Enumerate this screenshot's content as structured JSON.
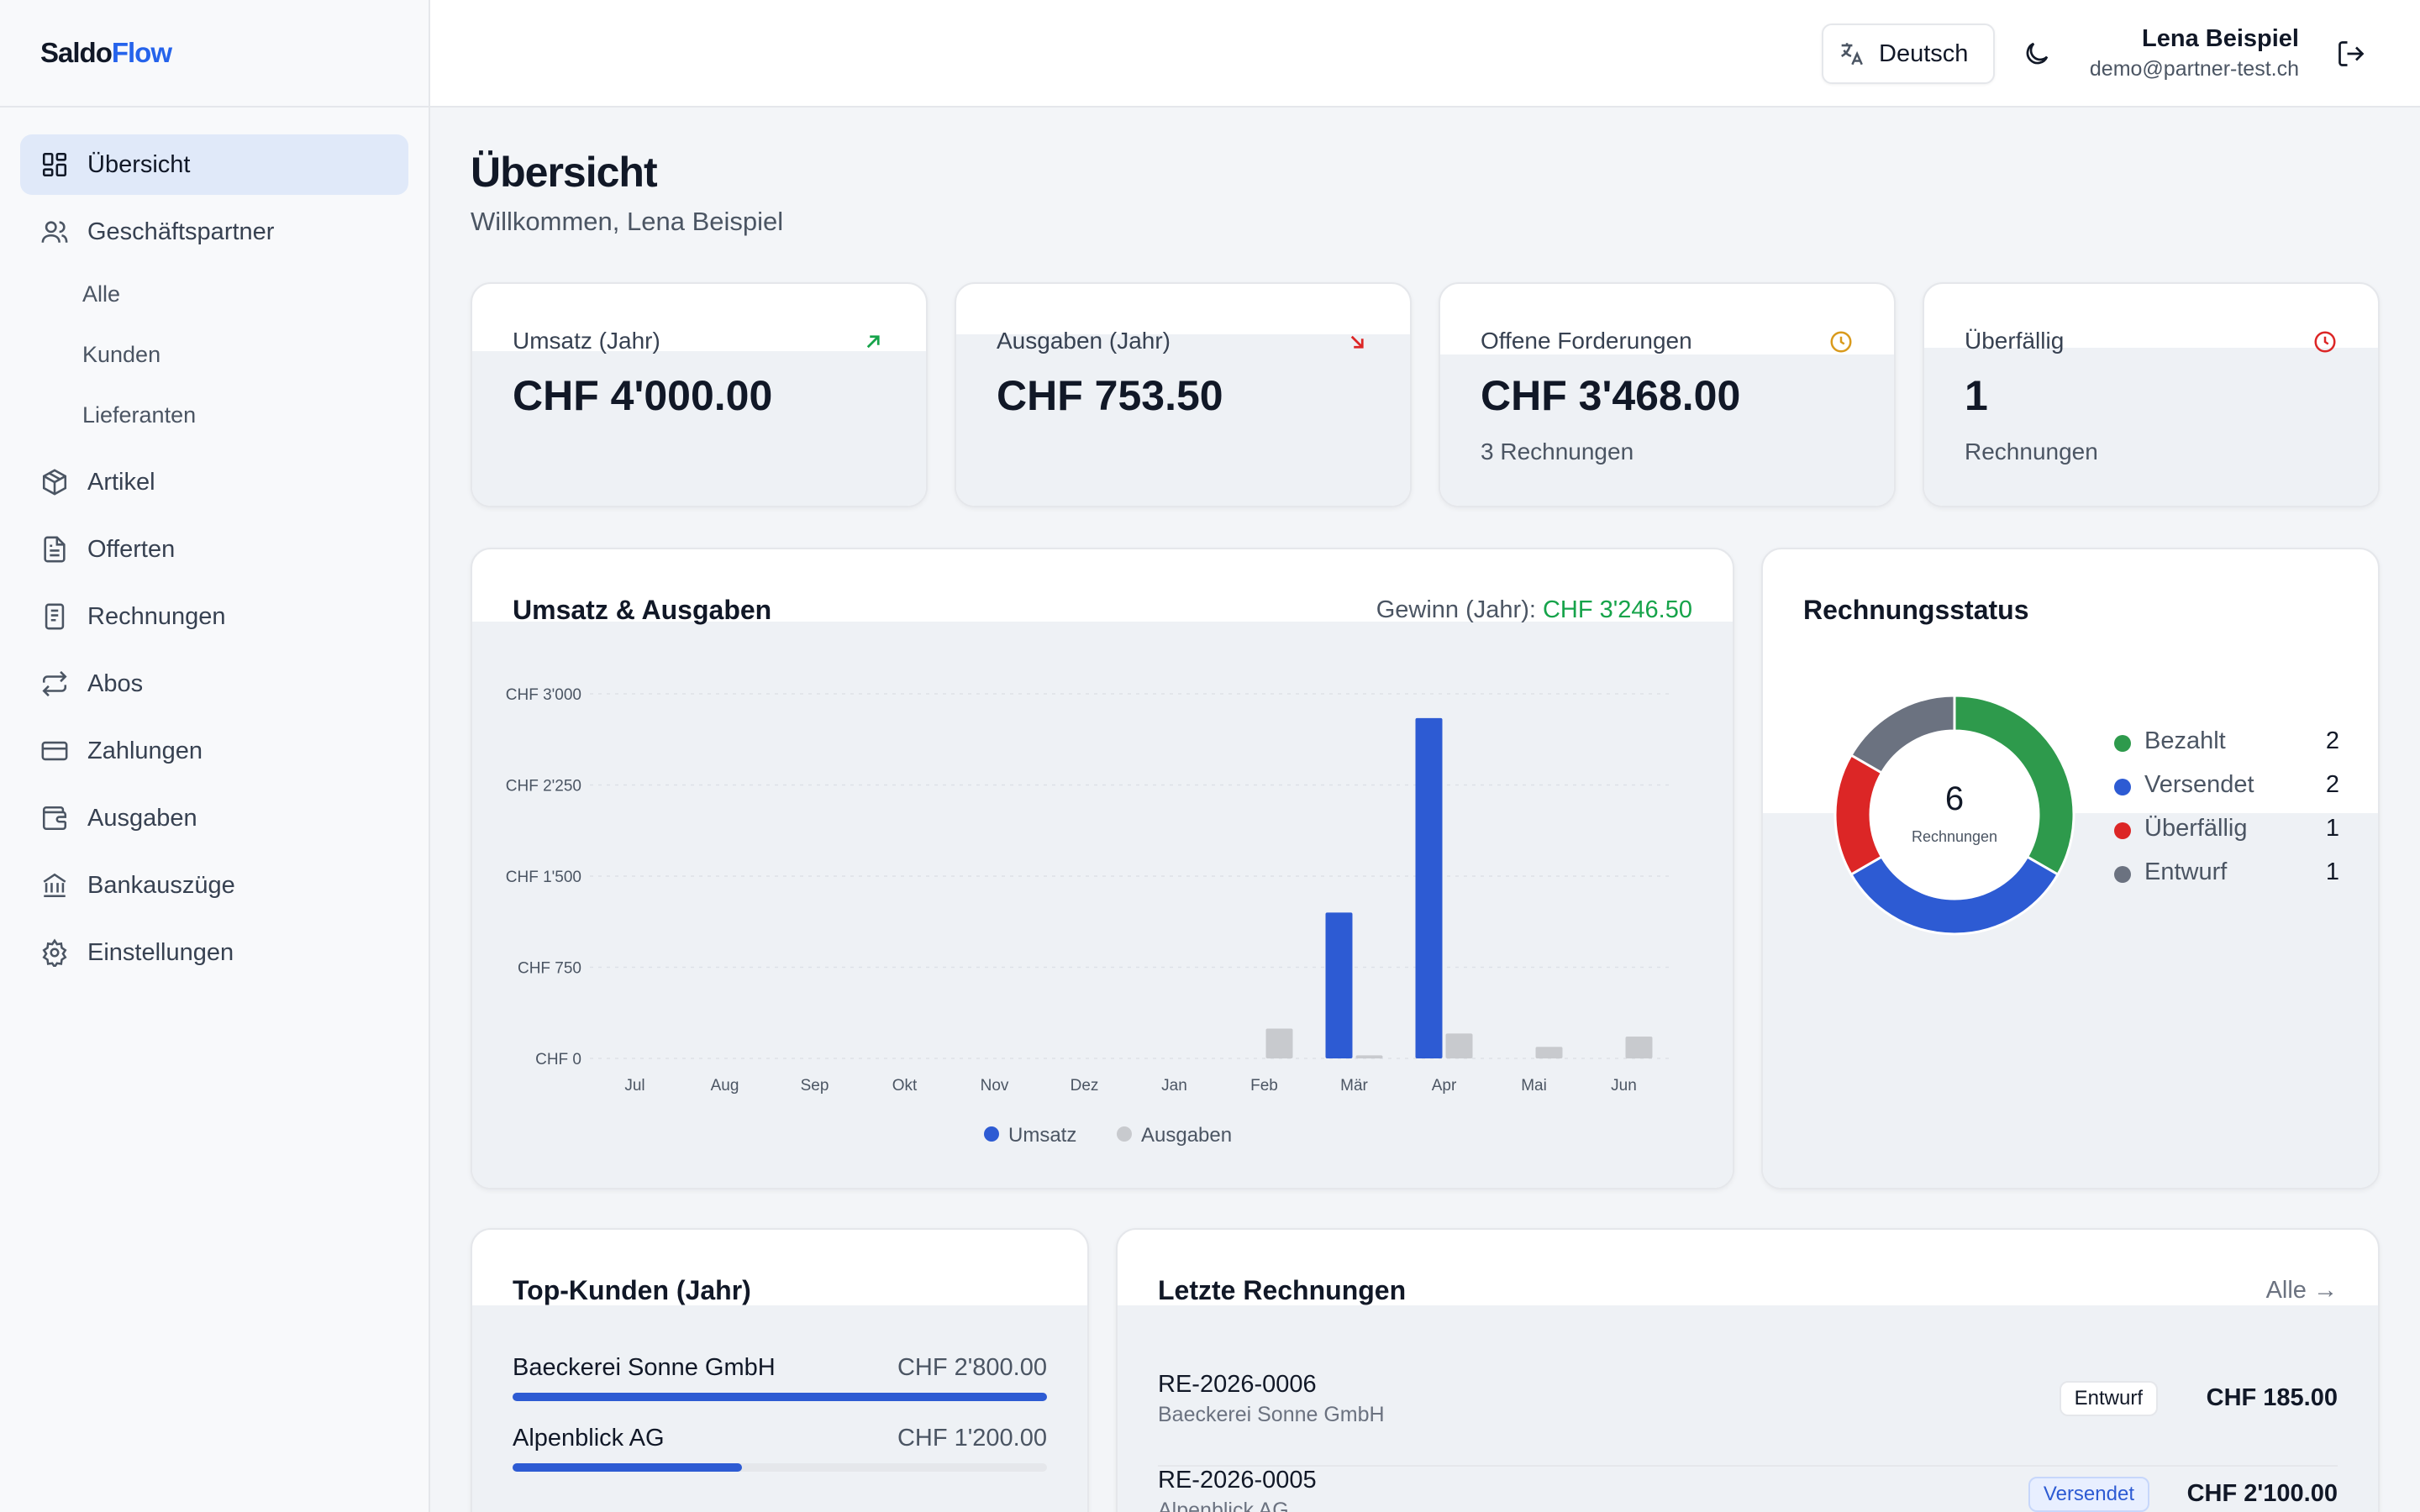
{
  "brand": {
    "part1": "Saldo",
    "part2": "Flow"
  },
  "sidebar": {
    "items": [
      {
        "label": "Übersicht",
        "icon": "dashboard-icon"
      },
      {
        "label": "Geschäftspartner",
        "icon": "users-icon"
      },
      {
        "label": "Artikel",
        "icon": "package-icon"
      },
      {
        "label": "Offerten",
        "icon": "file-text-icon"
      },
      {
        "label": "Rechnungen",
        "icon": "receipt-icon"
      },
      {
        "label": "Abos",
        "icon": "repeat-icon"
      },
      {
        "label": "Zahlungen",
        "icon": "credit-card-icon"
      },
      {
        "label": "Ausgaben",
        "icon": "wallet-icon"
      },
      {
        "label": "Bankauszüge",
        "icon": "bank-icon"
      },
      {
        "label": "Einstellungen",
        "icon": "gear-icon"
      }
    ],
    "partner_sub": [
      "Alle",
      "Kunden",
      "Lieferanten"
    ]
  },
  "header": {
    "language": "Deutsch",
    "user_name": "Lena Beispiel",
    "user_email": "demo@partner-test.ch"
  },
  "page": {
    "title": "Übersicht",
    "welcome": "Willkommen, Lena Beispiel"
  },
  "kpis": [
    {
      "label": "Umsatz (Jahr)",
      "value": "CHF 4'000.00",
      "sub": "",
      "icon": "arrow-up-right-icon",
      "color": "#16a34a"
    },
    {
      "label": "Ausgaben (Jahr)",
      "value": "CHF 753.50",
      "sub": "",
      "icon": "arrow-down-right-icon",
      "color": "#dc2626"
    },
    {
      "label": "Offene Forderungen",
      "value": "CHF 3'468.00",
      "sub": "3 Rechnungen",
      "icon": "clock-icon",
      "color": "#d99a1c"
    },
    {
      "label": "Überfällig",
      "value": "1",
      "sub": "Rechnungen",
      "icon": "clock-icon",
      "color": "#dc2626"
    }
  ],
  "revenue_chart": {
    "title": "Umsatz & Ausgaben",
    "profit_label": "Gewinn (Jahr):",
    "profit_value": "CHF 3'246.50"
  },
  "chart_data": {
    "type": "bar",
    "categories": [
      "Jul",
      "Aug",
      "Sep",
      "Okt",
      "Nov",
      "Dez",
      "Jan",
      "Feb",
      "Mär",
      "Apr",
      "Mai",
      "Jun"
    ],
    "series": [
      {
        "name": "Umsatz",
        "color": "#2d5bd3",
        "values": [
          0,
          0,
          0,
          0,
          0,
          0,
          0,
          0,
          1200,
          2800,
          0,
          0
        ]
      },
      {
        "name": "Ausgaben",
        "color": "#c8cace",
        "values": [
          0,
          0,
          0,
          0,
          0,
          0,
          0,
          245,
          25,
          205,
          95,
          180
        ]
      }
    ],
    "yticks": [
      "CHF 0",
      "CHF 750",
      "CHF 1'500",
      "CHF 2'250",
      "CHF 3'000"
    ],
    "ylim": [
      0,
      3000
    ],
    "grid": true,
    "legend": "bottom"
  },
  "status": {
    "title": "Rechnungsstatus",
    "total": "6",
    "total_label": "Rechnungen",
    "items": [
      {
        "label": "Bezahlt",
        "count": 2,
        "color": "#2e9a4c"
      },
      {
        "label": "Versendet",
        "count": 2,
        "color": "#2d5bd3"
      },
      {
        "label": "Überfällig",
        "count": 1,
        "color": "#dc2626"
      },
      {
        "label": "Entwurf",
        "count": 1,
        "color": "#6b7280"
      }
    ]
  },
  "top_customers": {
    "title": "Top-Kunden (Jahr)",
    "items": [
      {
        "name": "Baeckerei Sonne GmbH",
        "value": "CHF 2'800.00",
        "share": 1.0
      },
      {
        "name": "Alpenblick AG",
        "value": "CHF 1'200.00",
        "share": 0.43
      }
    ]
  },
  "recent_invoices": {
    "title": "Letzte Rechnungen",
    "all_link": "Alle →",
    "items": [
      {
        "number": "RE-2026-0006",
        "customer": "Baeckerei Sonne GmbH",
        "status": "Entwurf",
        "amount": "CHF 185.00"
      },
      {
        "number": "RE-2026-0005",
        "customer": "Alpenblick AG",
        "status": "Versendet",
        "amount": "CHF 2'100.00"
      }
    ]
  }
}
